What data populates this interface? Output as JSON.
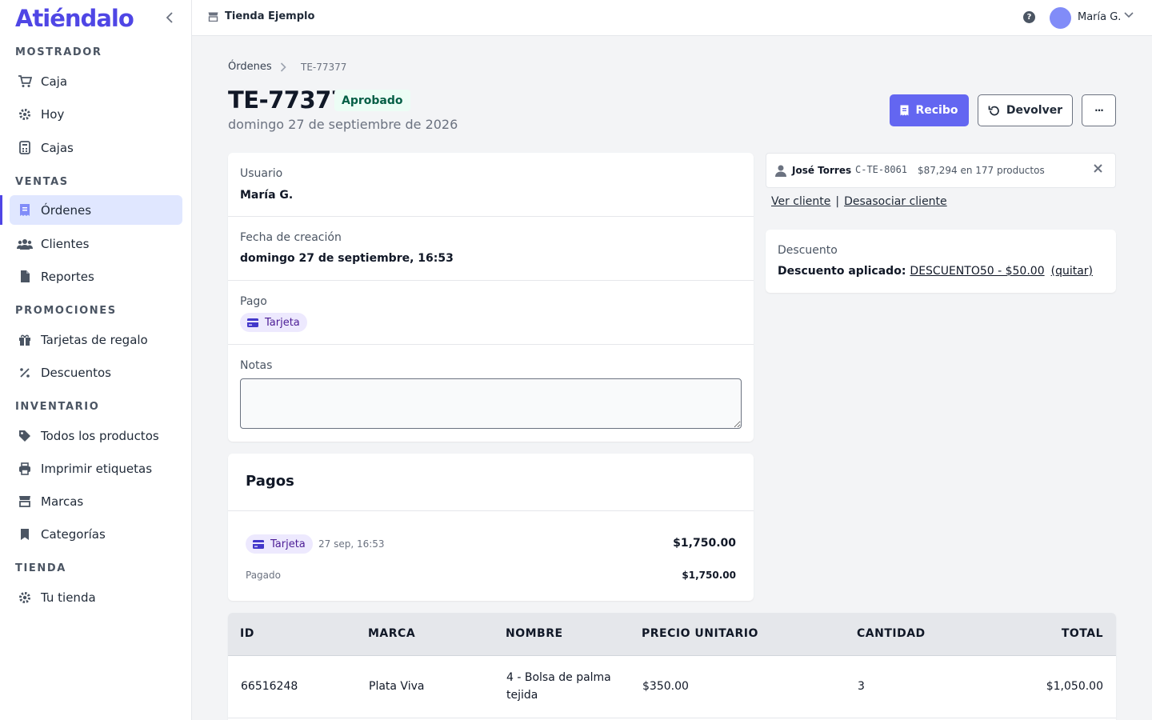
{
  "brand": {
    "logo": "Atiéndalo",
    "accent": "#4f46e5"
  },
  "sidebar": {
    "sections": [
      {
        "title": "MOSTRADOR",
        "items": [
          {
            "label": "Caja",
            "icon": "cart-icon"
          },
          {
            "label": "Hoy",
            "icon": "gear-icon"
          },
          {
            "label": "Cajas",
            "icon": "calculator-icon"
          }
        ]
      },
      {
        "title": "VENTAS",
        "items": [
          {
            "label": "Órdenes",
            "icon": "receipt-icon",
            "active": true
          },
          {
            "label": "Clientes",
            "icon": "users-icon"
          },
          {
            "label": "Reportes",
            "icon": "document-icon"
          }
        ]
      },
      {
        "title": "PROMOCIONES",
        "items": [
          {
            "label": "Tarjetas de regalo",
            "icon": "gift-icon"
          },
          {
            "label": "Descuentos",
            "icon": "percent-icon"
          }
        ]
      },
      {
        "title": "INVENTARIO",
        "items": [
          {
            "label": "Todos los productos",
            "icon": "tag-icon"
          },
          {
            "label": "Imprimir etiquetas",
            "icon": "printer-icon"
          },
          {
            "label": "Marcas",
            "icon": "store-icon"
          },
          {
            "label": "Categorías",
            "icon": "bookmark-icon"
          }
        ]
      },
      {
        "title": "TIENDA",
        "items": [
          {
            "label": "Tu tienda",
            "icon": "gear-icon"
          }
        ]
      }
    ]
  },
  "topbar": {
    "store_name": "Tienda Ejemplo",
    "help": "?",
    "user_name": "María G."
  },
  "breadcrumb": {
    "parent": "Órdenes",
    "current": "TE-77377"
  },
  "order": {
    "id": "TE-77377",
    "status": "Aprobado",
    "date": "domingo 27 de septiembre de 2026",
    "actions": {
      "receipt": "Recibo",
      "refund": "Devolver",
      "more": "···"
    }
  },
  "details": {
    "user_label": "Usuario",
    "user_value": "María G.",
    "created_label": "Fecha de creación",
    "created_value": "domingo 27 de septiembre, 16:53",
    "payment_label": "Pago",
    "payment_method": "Tarjeta",
    "notes_label": "Notas",
    "notes_value": ""
  },
  "payments": {
    "title": "Pagos",
    "entries": [
      {
        "method": "Tarjeta",
        "time": "27 sep, 16:53",
        "amount": "$1,750.00"
      }
    ],
    "paid_label": "Pagado",
    "paid_amount": "$1,750.00"
  },
  "client": {
    "name": "José Torres",
    "code": "C-TE-8061",
    "stats": "$87,294 en 177 productos",
    "view_link": "Ver cliente",
    "separator": "|",
    "unlink_link": "Desasociar cliente"
  },
  "discount": {
    "label": "Descuento",
    "applied_label": "Descuento aplicado:",
    "code": "DESCUENTO50 - $50.00",
    "remove": "(quitar)"
  },
  "items_table": {
    "columns": [
      "ID",
      "MARCA",
      "NOMBRE",
      "PRECIO UNITARIO",
      "CANTIDAD",
      "TOTAL"
    ],
    "rows": [
      {
        "id": "66516248",
        "brand": "Plata Viva",
        "name": "4 - Bolsa de palma tejida",
        "unit_price": "$350.00",
        "qty": "3",
        "total": "$1,050.00"
      }
    ]
  }
}
